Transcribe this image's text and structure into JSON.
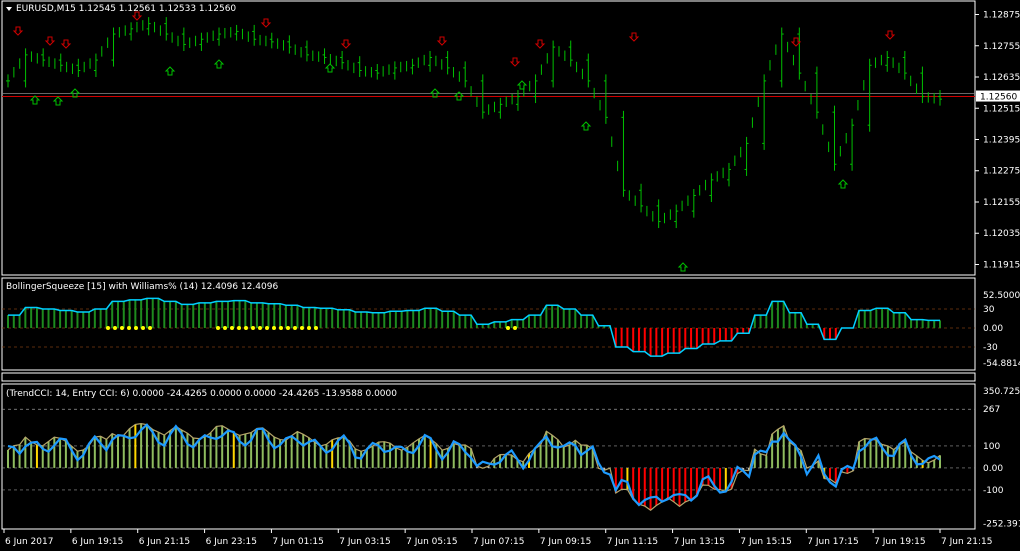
{
  "main": {
    "symbol_info": "EURUSD,M15  1.12545 1.12561 1.12533 1.12560",
    "price_axis": [
      "1.12875",
      "1.12755",
      "1.12635",
      "1.12515",
      "1.12395",
      "1.12275",
      "1.12155",
      "1.12035",
      "1.11915"
    ],
    "current_price": "1.12560",
    "ylim": [
      1.1189,
      1.129
    ],
    "candle_color": "#00c000",
    "up_arrow_color": "#00c000",
    "down_arrow_color": "#d00000",
    "price_line_color": "#d00000"
  },
  "indicator1": {
    "title": "BollingerSqueeze [15] with Williams% (14) 12.4096 12.4096",
    "levels": [
      "52.5000",
      "30",
      "0.00",
      "-30",
      "-54.8814"
    ],
    "positive_color": "#1e8b1e",
    "negative_color": "#ff0000",
    "line_color": "#00d0ff",
    "dot_color": "#ffff00"
  },
  "indicator2": {
    "title": "(TrendCCI: 14, Entry CCI: 6)  0.0000 -24.4265 0.0000 0.0000 -24.4265 -13.9588 0.0000",
    "levels": [
      "350.7255",
      "267",
      "100",
      "0.00",
      "-100",
      "-252.3917"
    ],
    "line_color": "#1e9bff",
    "bar_up_color": "#8fbc5f",
    "bar_down_color": "#ff0000",
    "bar_neutral_color": "#bfbfbf",
    "bar_entry_color": "#ffd700"
  },
  "time_axis": [
    "6 Jun 2017",
    "6 Jun 19:15",
    "6 Jun 21:15",
    "6 Jun 23:15",
    "7 Jun 01:15",
    "7 Jun 03:15",
    "7 Jun 05:15",
    "7 Jun 07:15",
    "7 Jun 09:15",
    "7 Jun 11:15",
    "7 Jun 13:15",
    "7 Jun 15:15",
    "7 Jun 17:15",
    "7 Jun 19:15",
    "7 Jun 21:15"
  ],
  "chart_data": {
    "type": "candlestick",
    "series": [
      {
        "name": "EURUSD,M15",
        "values": [
          1.1262,
          1.1272,
          1.127,
          1.1268,
          1.1266,
          1.127,
          1.128,
          1.1282,
          1.1284,
          1.128,
          1.1276,
          1.1278,
          1.128,
          1.1281,
          1.1278,
          1.1277,
          1.1275,
          1.1272,
          1.1271,
          1.1269,
          1.1266,
          1.1265,
          1.1267,
          1.1268,
          1.1271,
          1.1267,
          1.1262,
          1.125,
          1.1253,
          1.1256,
          1.1262,
          1.1275,
          1.127,
          1.1262,
          1.1248,
          1.122,
          1.1214,
          1.1208,
          1.1212,
          1.1218,
          1.1224,
          1.1228,
          1.1238,
          1.1262,
          1.128,
          1.1265,
          1.125,
          1.123,
          1.1245,
          1.1268,
          1.1271,
          1.1265,
          1.1256,
          1.1255
        ]
      }
    ]
  }
}
